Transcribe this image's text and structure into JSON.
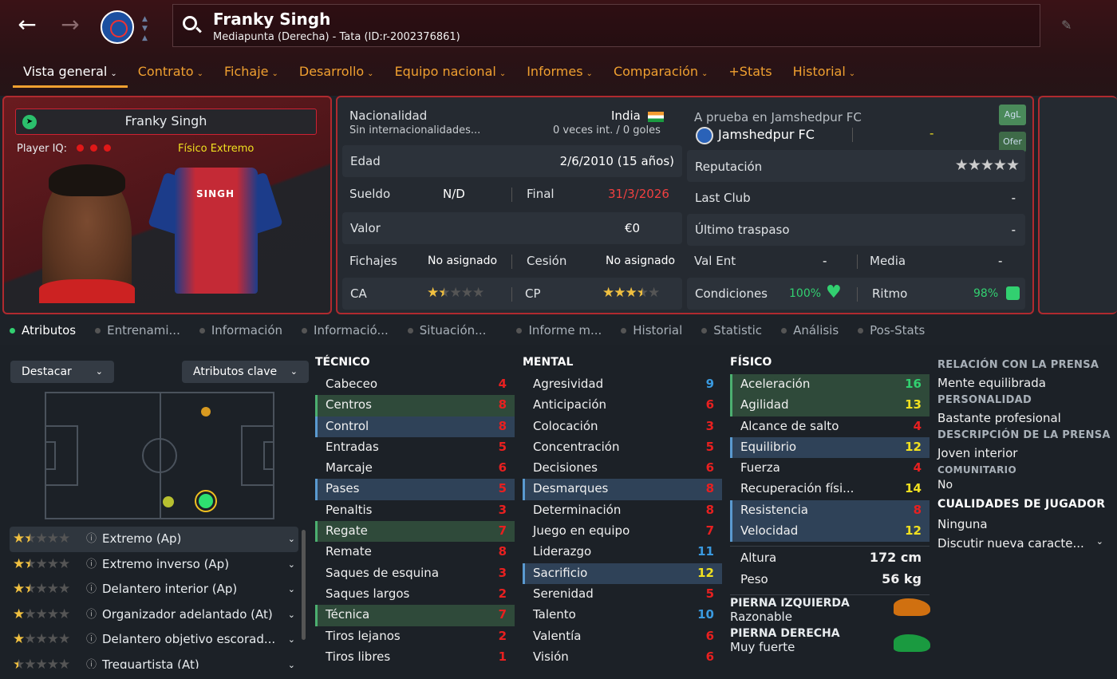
{
  "header": {
    "player_name": "Franky Singh",
    "subtitle": "Mediapunta (Derecha) - Tata (ID:r-2002376861)"
  },
  "tabs": [
    {
      "label": "Vista general"
    },
    {
      "label": "Contrato"
    },
    {
      "label": "Fichaje"
    },
    {
      "label": "Desarrollo"
    },
    {
      "label": "Equipo nacional"
    },
    {
      "label": "Informes"
    },
    {
      "label": "Comparación"
    },
    {
      "label": "+Stats"
    },
    {
      "label": "Historial"
    }
  ],
  "profile": {
    "name": "Franky Singh",
    "iq_label": "Player IQ:",
    "physical_label": "Físico Extremo",
    "shirt_name": "SINGH"
  },
  "info": {
    "nationality_label": "Nacionalidad",
    "nationality": "India",
    "caps_note": "Sin internacionalidades...",
    "caps": "0 veces int. / 0 goles",
    "age_label": "Edad",
    "age": "2/6/2010 (15 años)",
    "wage_label": "Sueldo",
    "wage": "N/D",
    "end_label": "Final",
    "end": "31/3/2026",
    "value_label": "Valor",
    "value": "€0",
    "transfer_label": "Fichajes",
    "transfer": "No asignado",
    "loan_label": "Cesión",
    "loan": "No asignado",
    "ca_label": "CA",
    "ca_stars": 1.5,
    "cp_label": "CP",
    "cp_stars": 3.5
  },
  "club": {
    "trial": "A prueba en Jamshedpur FC",
    "club": "Jamshedpur FC",
    "dash": "-",
    "rep_label": "Reputación",
    "rep_stars": 0,
    "last_club_label": "Last Club",
    "last_club": "-",
    "last_transfer_label": "Último traspaso",
    "last_transfer": "-",
    "val_ent_label": "Val Ent",
    "val_ent": "-",
    "media_label": "Media",
    "media": "-",
    "cond_label": "Condiciones",
    "cond": "100%",
    "ritmo_label": "Ritmo",
    "ritmo": "98%",
    "btn_agl": "AgL",
    "btn_ofer": "Ofer"
  },
  "subtabs": [
    {
      "label": "Atributos"
    },
    {
      "label": "Entrenami..."
    },
    {
      "label": "Información"
    },
    {
      "label": "Informació..."
    },
    {
      "label": "Situación..."
    },
    {
      "label": "Informe m..."
    },
    {
      "label": "Historial"
    },
    {
      "label": "Statistic"
    },
    {
      "label": "Análisis"
    },
    {
      "label": "Pos-Stats"
    }
  ],
  "filters": {
    "highlight": "Destacar",
    "key_attrs": "Atributos clave"
  },
  "roles": [
    {
      "stars": 1.5,
      "label": "Extremo (Ap)"
    },
    {
      "stars": 1.5,
      "label": "Extremo inverso (Ap)"
    },
    {
      "stars": 1.5,
      "label": "Delantero interior (Ap)"
    },
    {
      "stars": 1,
      "label": "Organizador adelantado (At)"
    },
    {
      "stars": 1,
      "label": "Delantero objetivo escorad..."
    },
    {
      "stars": 0.5,
      "label": "Trequartista (At)"
    }
  ],
  "tecnico": {
    "title": "TÉCNICO",
    "attrs": [
      {
        "name": "Cabeceo",
        "val": "4",
        "hl": "",
        "col": "red"
      },
      {
        "name": "Centros",
        "val": "8",
        "hl": "g",
        "col": "red"
      },
      {
        "name": "Control",
        "val": "8",
        "hl": "b",
        "col": "red"
      },
      {
        "name": "Entradas",
        "val": "5",
        "hl": "",
        "col": "red"
      },
      {
        "name": "Marcaje",
        "val": "6",
        "hl": "",
        "col": "red"
      },
      {
        "name": "Pases",
        "val": "5",
        "hl": "b",
        "col": "red"
      },
      {
        "name": "Penaltis",
        "val": "3",
        "hl": "",
        "col": "red"
      },
      {
        "name": "Regate",
        "val": "7",
        "hl": "g",
        "col": "red"
      },
      {
        "name": "Remate",
        "val": "8",
        "hl": "",
        "col": "red"
      },
      {
        "name": "Saques de esquina",
        "val": "3",
        "hl": "",
        "col": "red"
      },
      {
        "name": "Saques largos",
        "val": "2",
        "hl": "",
        "col": "red"
      },
      {
        "name": "Técnica",
        "val": "7",
        "hl": "g",
        "col": "red"
      },
      {
        "name": "Tiros lejanos",
        "val": "2",
        "hl": "",
        "col": "red"
      },
      {
        "name": "Tiros libres",
        "val": "1",
        "hl": "",
        "col": "red"
      }
    ]
  },
  "mental": {
    "title": "MENTAL",
    "attrs": [
      {
        "name": "Agresividad",
        "val": "9",
        "hl": "",
        "col": "blu"
      },
      {
        "name": "Anticipación",
        "val": "6",
        "hl": "",
        "col": "red"
      },
      {
        "name": "Colocación",
        "val": "3",
        "hl": "",
        "col": "red"
      },
      {
        "name": "Concentración",
        "val": "5",
        "hl": "",
        "col": "red"
      },
      {
        "name": "Decisiones",
        "val": "6",
        "hl": "",
        "col": "red"
      },
      {
        "name": "Desmarques",
        "val": "8",
        "hl": "b",
        "col": "red"
      },
      {
        "name": "Determinación",
        "val": "8",
        "hl": "",
        "col": "red"
      },
      {
        "name": "Juego en equipo",
        "val": "7",
        "hl": "",
        "col": "red"
      },
      {
        "name": "Liderazgo",
        "val": "11",
        "hl": "",
        "col": "blu"
      },
      {
        "name": "Sacrificio",
        "val": "12",
        "hl": "b",
        "col": "yel"
      },
      {
        "name": "Serenidad",
        "val": "5",
        "hl": "",
        "col": "red"
      },
      {
        "name": "Talento",
        "val": "10",
        "hl": "",
        "col": "blu"
      },
      {
        "name": "Valentía",
        "val": "6",
        "hl": "",
        "col": "red"
      },
      {
        "name": "Visión",
        "val": "6",
        "hl": "",
        "col": "red"
      }
    ]
  },
  "fisico": {
    "title": "FÍSICO",
    "attrs": [
      {
        "name": "Aceleración",
        "val": "16",
        "hl": "g",
        "col": "grn"
      },
      {
        "name": "Agilidad",
        "val": "13",
        "hl": "g",
        "col": "yel"
      },
      {
        "name": "Alcance de salto",
        "val": "4",
        "hl": "",
        "col": "red"
      },
      {
        "name": "Equilibrio",
        "val": "12",
        "hl": "b",
        "col": "yel"
      },
      {
        "name": "Fuerza",
        "val": "4",
        "hl": "",
        "col": "red"
      },
      {
        "name": "Recuperación físi...",
        "val": "14",
        "hl": "",
        "col": "yel"
      },
      {
        "name": "Resistencia",
        "val": "8",
        "hl": "b",
        "col": "red"
      },
      {
        "name": "Velocidad",
        "val": "12",
        "hl": "b",
        "col": "yel"
      }
    ],
    "height_label": "Altura",
    "height": "172 cm",
    "weight_label": "Peso",
    "weight": "56 kg",
    "left_foot_label": "PIERNA IZQUIERDA",
    "left_foot": "Razonable",
    "right_foot_label": "PIERNA DERECHA",
    "right_foot": "Muy fuerte"
  },
  "side": {
    "press_label": "RELACIÓN CON LA PRENSA",
    "press": "Mente equilibrada",
    "personality_label": "PERSONALIDAD",
    "personality": "Bastante profesional",
    "press_desc_label": "DESCRIPCIÓN DE LA PRENSA",
    "press_desc": "Joven interior",
    "community_label": "COMUNITARIO",
    "community": "No",
    "traits_label": "CUALIDADES DE JUGADOR",
    "traits": "Ninguna",
    "discuss": "Discutir nueva caracte..."
  }
}
